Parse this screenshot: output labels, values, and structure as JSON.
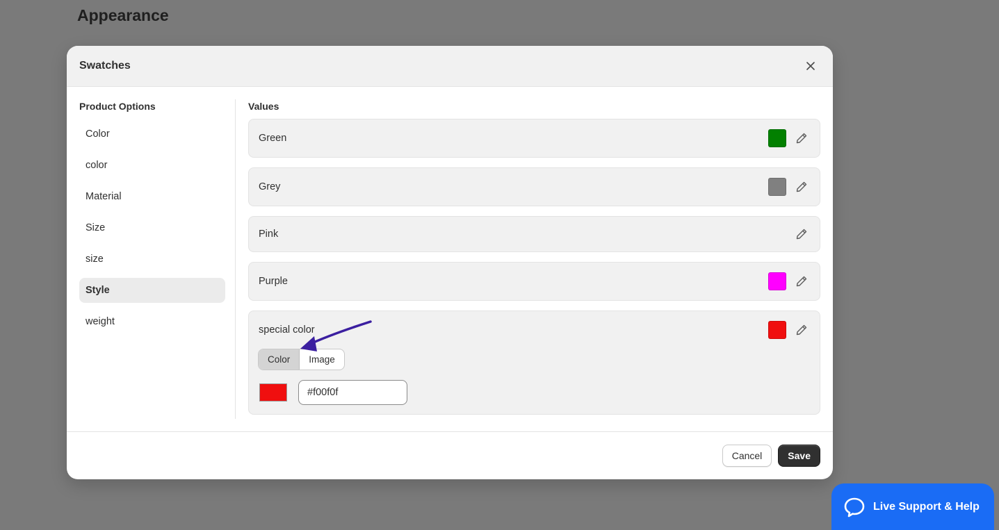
{
  "page": {
    "title": "Appearance"
  },
  "modal": {
    "title": "Swatches",
    "options_heading": "Product Options",
    "options": [
      {
        "label": "Color",
        "active": false
      },
      {
        "label": "color",
        "active": false
      },
      {
        "label": "Material",
        "active": false
      },
      {
        "label": "Size",
        "active": false
      },
      {
        "label": "size",
        "active": false
      },
      {
        "label": "Style",
        "active": true
      },
      {
        "label": "weight",
        "active": false
      }
    ],
    "values_heading": "Values",
    "values": [
      {
        "label": "Green",
        "swatch": "#028000"
      },
      {
        "label": "Grey",
        "swatch": "#808080"
      },
      {
        "label": "Pink",
        "swatch": null
      },
      {
        "label": "Purple",
        "swatch": "#ff00ff"
      },
      {
        "label": "special color",
        "swatch": "#f00f0f",
        "expanded": true
      }
    ],
    "editor": {
      "tab_color": "Color",
      "tab_image": "Image",
      "active_tab": "Color",
      "hex_value": "#f00f0f",
      "preview_color": "#f00f0f"
    },
    "footer": {
      "cancel_label": "Cancel",
      "save_label": "Save"
    }
  },
  "support": {
    "label": "Live Support & Help",
    "color": "#1a6cf5"
  },
  "annotation_color": "#3b1fa0"
}
